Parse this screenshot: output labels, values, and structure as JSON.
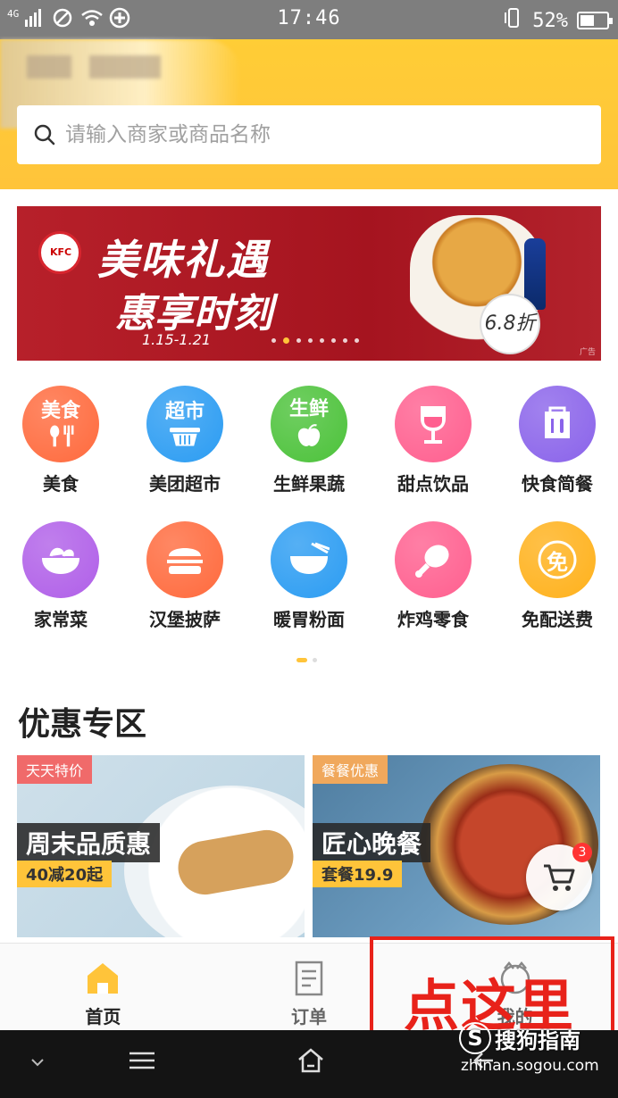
{
  "status_bar": {
    "network": "4G",
    "time": "17:46",
    "battery": "52%",
    "battery_level": 0.52
  },
  "search": {
    "placeholder": "请输入商家或商品名称"
  },
  "banner": {
    "headline": "美味礼遇",
    "subline": "惠享时刻",
    "dates": "1.15-1.21",
    "discount": "6.8折",
    "ad_tag": "广告",
    "brand": "KFC",
    "slide_count": 8,
    "active_slide": 2
  },
  "categories": [
    {
      "label": "美食",
      "icon_text": "美食",
      "icon": "fork-spoon-icon",
      "color": "#ff6a3d"
    },
    {
      "label": "美团超市",
      "icon_text": "超市",
      "icon": "basket-icon",
      "color": "#2b9cf2"
    },
    {
      "label": "生鲜果蔬",
      "icon_text": "生鲜",
      "icon": "apple-icon",
      "color": "#4cc23a"
    },
    {
      "label": "甜点饮品",
      "icon_text": "",
      "icon": "wine-glass-icon",
      "color": "#ff5f8f"
    },
    {
      "label": "快食简餐",
      "icon_text": "",
      "icon": "takeout-box-icon",
      "color": "#8a63ea"
    },
    {
      "label": "家常菜",
      "icon_text": "",
      "icon": "salad-bowl-icon",
      "color": "#b05fe8"
    },
    {
      "label": "汉堡披萨",
      "icon_text": "",
      "icon": "burger-icon",
      "color": "#ff6a3d"
    },
    {
      "label": "暖胃粉面",
      "icon_text": "",
      "icon": "noodle-bowl-icon",
      "color": "#2b9cf2"
    },
    {
      "label": "炸鸡零食",
      "icon_text": "",
      "icon": "drumstick-icon",
      "color": "#ff5f8f"
    },
    {
      "label": "免配送费",
      "icon_text": "免",
      "icon": "free-delivery-icon",
      "color": "#ffb11b"
    }
  ],
  "promo": {
    "title": "优惠专区",
    "cards": [
      {
        "tag": "天天特价",
        "name": "周末品质惠",
        "deal": "40减20起"
      },
      {
        "tag": "餐餐优惠",
        "name": "匠心晚餐",
        "deal": "套餐19.9"
      }
    ]
  },
  "cart": {
    "badge": "3"
  },
  "tabs": [
    {
      "label": "首页",
      "active": true
    },
    {
      "label": "订单",
      "active": false
    },
    {
      "label": "我的",
      "active": false
    }
  ],
  "annotation": {
    "text": "点这里"
  },
  "watermark": {
    "logo": "S",
    "text": "搜狗指南",
    "url": "zhinan.sogou.com"
  },
  "colors": {
    "brand_yellow": "#ffc43a",
    "annotation_red": "#e8221a",
    "banner_red": "#b7202a"
  }
}
